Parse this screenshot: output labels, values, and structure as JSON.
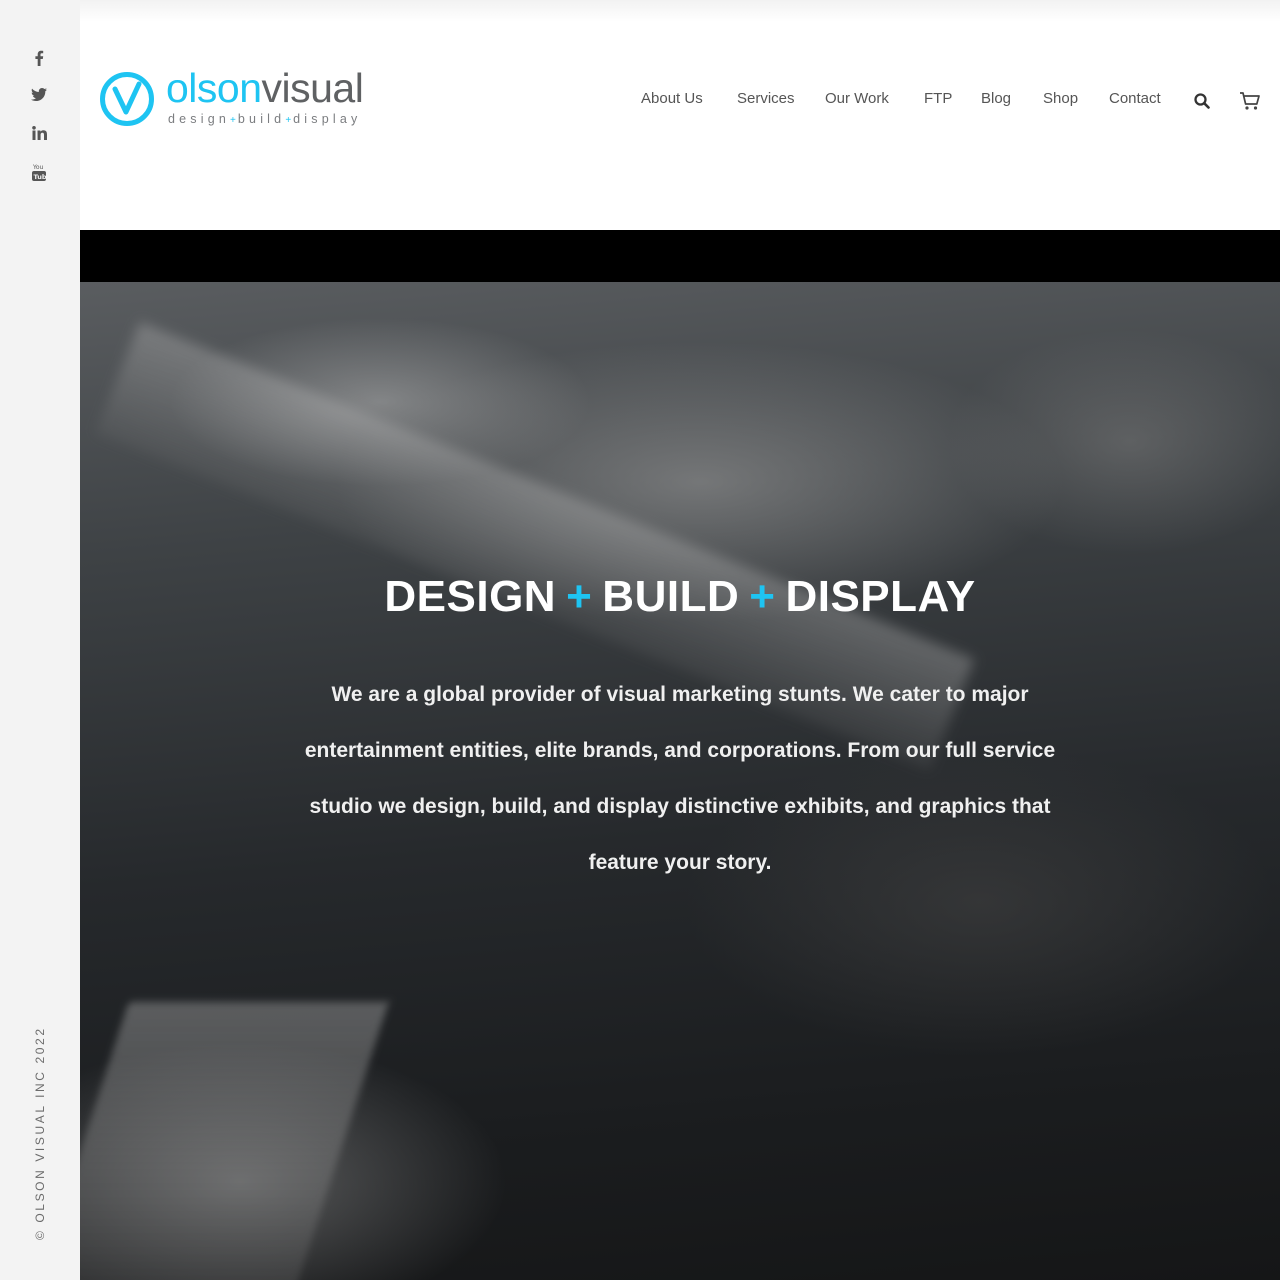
{
  "sidebar": {
    "social": [
      {
        "name": "facebook",
        "icon": "facebook-icon"
      },
      {
        "name": "twitter",
        "icon": "twitter-icon"
      },
      {
        "name": "linkedin",
        "icon": "linkedin-icon"
      },
      {
        "name": "youtube",
        "icon": "youtube-icon"
      }
    ],
    "copyright": "© OLSON VISUAL INC 2022"
  },
  "header": {
    "logo": {
      "word_part1": "olson",
      "word_part2": "visual",
      "tag_design": "design",
      "tag_build": "build",
      "tag_display": "display",
      "tag_plus": "+"
    },
    "nav": [
      {
        "label": "About Us"
      },
      {
        "label": "Services"
      },
      {
        "label": "Our Work"
      },
      {
        "label": "FTP"
      },
      {
        "label": "Blog"
      },
      {
        "label": "Shop"
      },
      {
        "label": "Contact"
      }
    ],
    "icons": {
      "search": "search-icon",
      "cart": "cart-icon"
    }
  },
  "hero": {
    "title_part1": "DESIGN",
    "title_part2": "BUILD",
    "title_part3": "DISPLAY",
    "title_plus": "+",
    "body": "We are a global provider of visual marketing stunts. We cater to major entertainment entities, elite brands, and corporations. From our full service studio we design, build, and display distinctive exhibits, and graphics that feature your story."
  },
  "colors": {
    "accent": "#1ec4f2",
    "logo_gray": "#5f6163",
    "sidebar_bg": "#f3f3f3"
  }
}
